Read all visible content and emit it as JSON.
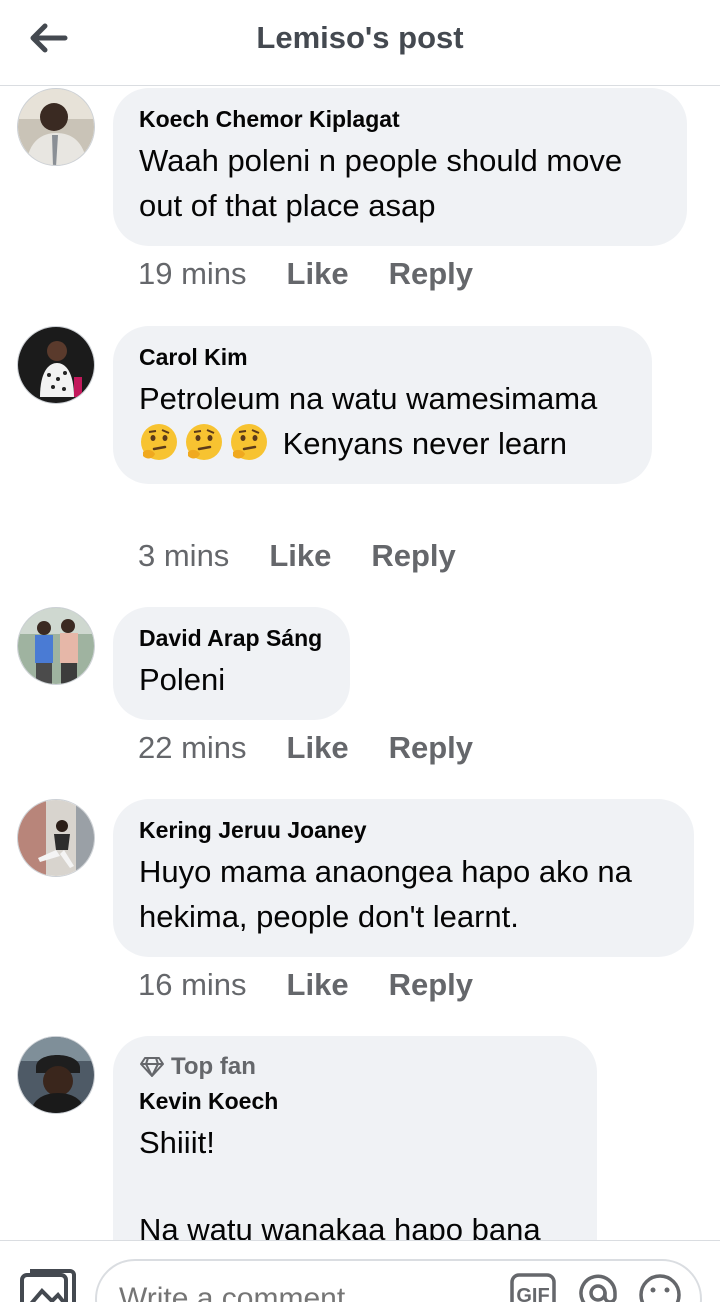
{
  "header": {
    "title": "Lemiso's post",
    "back_icon": "arrow-left-icon"
  },
  "comments": [
    {
      "author": "Koech Chemor Kiplagat",
      "text": "Waah poleni n people should move out of that place asap",
      "time": "19 mins",
      "like": "Like",
      "reply": "Reply"
    },
    {
      "author": "Carol Kim",
      "text_before": "Petroleum na watu wamesimama",
      "emoji": [
        "thinking-face-icon",
        "thinking-face-icon",
        "thinking-face-icon"
      ],
      "text_after": "Kenyans never learn",
      "time": "3 mins",
      "like": "Like",
      "reply": "Reply"
    },
    {
      "author": "David Arap Sáng",
      "text": "Poleni",
      "time": "22 mins",
      "like": "Like",
      "reply": "Reply"
    },
    {
      "author": "Kering Jeruu Joaney",
      "text": "Huyo mama anaongea hapo ako na hekima, people don't learnt.",
      "time": "16 mins",
      "like": "Like",
      "reply": "Reply"
    },
    {
      "badge": "Top fan",
      "badge_icon": "diamond-icon",
      "author": "Kevin Koech",
      "text_line1": "Shiiit!",
      "text_line2": "Na watu wanakaa hapo bana"
    }
  ],
  "composer": {
    "placeholder": "Write a comment...",
    "photo_icon": "photo-icon",
    "gif_label": "GIF",
    "mention_icon": "at-sign-icon",
    "emoji_icon": "smiley-icon"
  },
  "colors": {
    "bubble": "#f0f2f5",
    "meta_text": "#65676b",
    "header_text": "#444950"
  }
}
